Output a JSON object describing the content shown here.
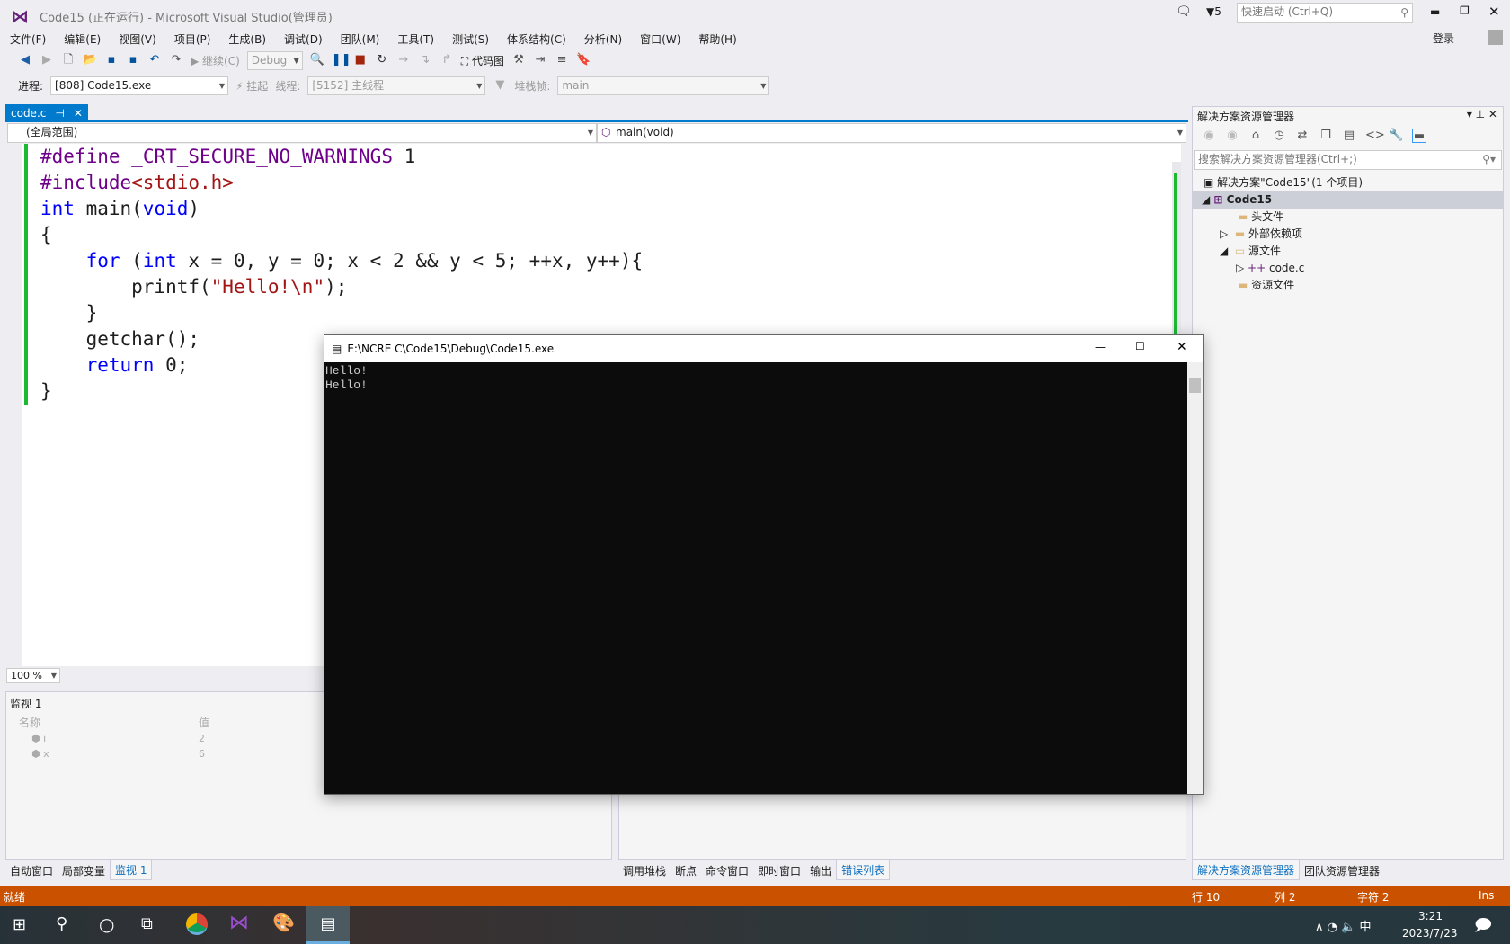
{
  "window": {
    "title": "Code15 (正在运行) - Microsoft Visual Studio(管理员)",
    "notifications": "5",
    "quick_launch_placeholder": "快速启动 (Ctrl+Q)",
    "sign_in": "登录"
  },
  "menu": [
    "文件(F)",
    "编辑(E)",
    "视图(V)",
    "项目(P)",
    "生成(B)",
    "调试(D)",
    "团队(M)",
    "工具(T)",
    "测试(S)",
    "体系结构(C)",
    "分析(N)",
    "窗口(W)",
    "帮助(H)"
  ],
  "toolbar": {
    "continue": "继续(C)",
    "config": "Debug",
    "code_map": "代码图",
    "process_label": "进程:",
    "process": "[808] Code15.exe",
    "suspend": "挂起",
    "thread_label": "线程:",
    "thread": "[5152] 主线程",
    "stack_label": "堆栈帧:",
    "stack": "main"
  },
  "editor": {
    "tab": "code.c",
    "scope": "(全局范围)",
    "function": "main(void)",
    "zoom": "100 %"
  },
  "console": {
    "title": "E:\\NCRE C\\Code15\\Debug\\Code15.exe",
    "output": "Hello!\nHello!"
  },
  "watch": {
    "title": "监视 1",
    "col_name": "名称",
    "col_value": "值",
    "rows": [
      {
        "name": "i",
        "value": "2"
      },
      {
        "name": "x",
        "value": "6"
      }
    ]
  },
  "bottom_tabs_left": [
    "自动窗口",
    "局部变量",
    "监视 1"
  ],
  "bottom_tabs_mid": [
    "调用堆栈",
    "断点",
    "命令窗口",
    "即时窗口",
    "输出",
    "错误列表"
  ],
  "solution": {
    "title": "解决方案资源管理器",
    "search_placeholder": "搜索解决方案资源管理器(Ctrl+;)",
    "root": "解决方案\"Code15\"(1 个项目)",
    "project": "Code15",
    "items": [
      "头文件",
      "外部依赖项",
      "源文件",
      "code.c",
      "资源文件"
    ],
    "tabs": [
      "解决方案资源管理器",
      "团队资源管理器"
    ]
  },
  "status": {
    "ready": "就绪",
    "line": "行 10",
    "col": "列 2",
    "char": "字符 2",
    "mode": "Ins"
  },
  "taskbar": {
    "time": "3:21",
    "date": "2023/7/23",
    "ime": "中"
  },
  "colors": {
    "accent": "#007acc",
    "status": "#ca5100"
  }
}
